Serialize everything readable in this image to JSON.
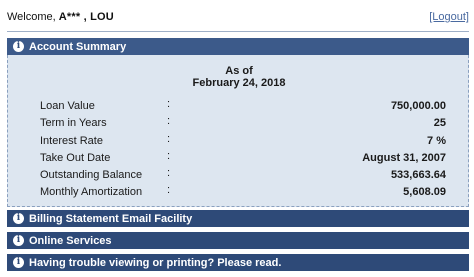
{
  "header": {
    "welcome_prefix": "Welcome, ",
    "user_name": "A*** , LOU",
    "logout_label": "[Logout]"
  },
  "account_summary": {
    "title": "Account Summary",
    "as_of_label": "As of",
    "as_of_date": "February 24, 2018",
    "rows": [
      {
        "label": "Loan Value",
        "separator": ":",
        "value": "750,000.00"
      },
      {
        "label": "Term in Years",
        "separator": ":",
        "value": "25"
      },
      {
        "label": "Interest Rate",
        "separator": ":",
        "value": "7 %"
      },
      {
        "label": "Take Out Date",
        "separator": ":",
        "value": "August 31, 2007"
      },
      {
        "label": "Outstanding Balance",
        "separator": ":",
        "value": "533,663.64"
      },
      {
        "label": "Monthly Amortization",
        "separator": ":",
        "value": "5,608.09"
      }
    ]
  },
  "sections": [
    {
      "title": "Billing Statement Email Facility"
    },
    {
      "title": "Online Services"
    },
    {
      "title": "Having trouble viewing or printing? Please read."
    }
  ],
  "icons": {
    "info": "info-icon"
  },
  "colors": {
    "panel_header": "#3c5a8a",
    "panel_header_dark": "#2e4a78",
    "summary_background": "#dde6f0",
    "link": "#4a6aa0"
  }
}
